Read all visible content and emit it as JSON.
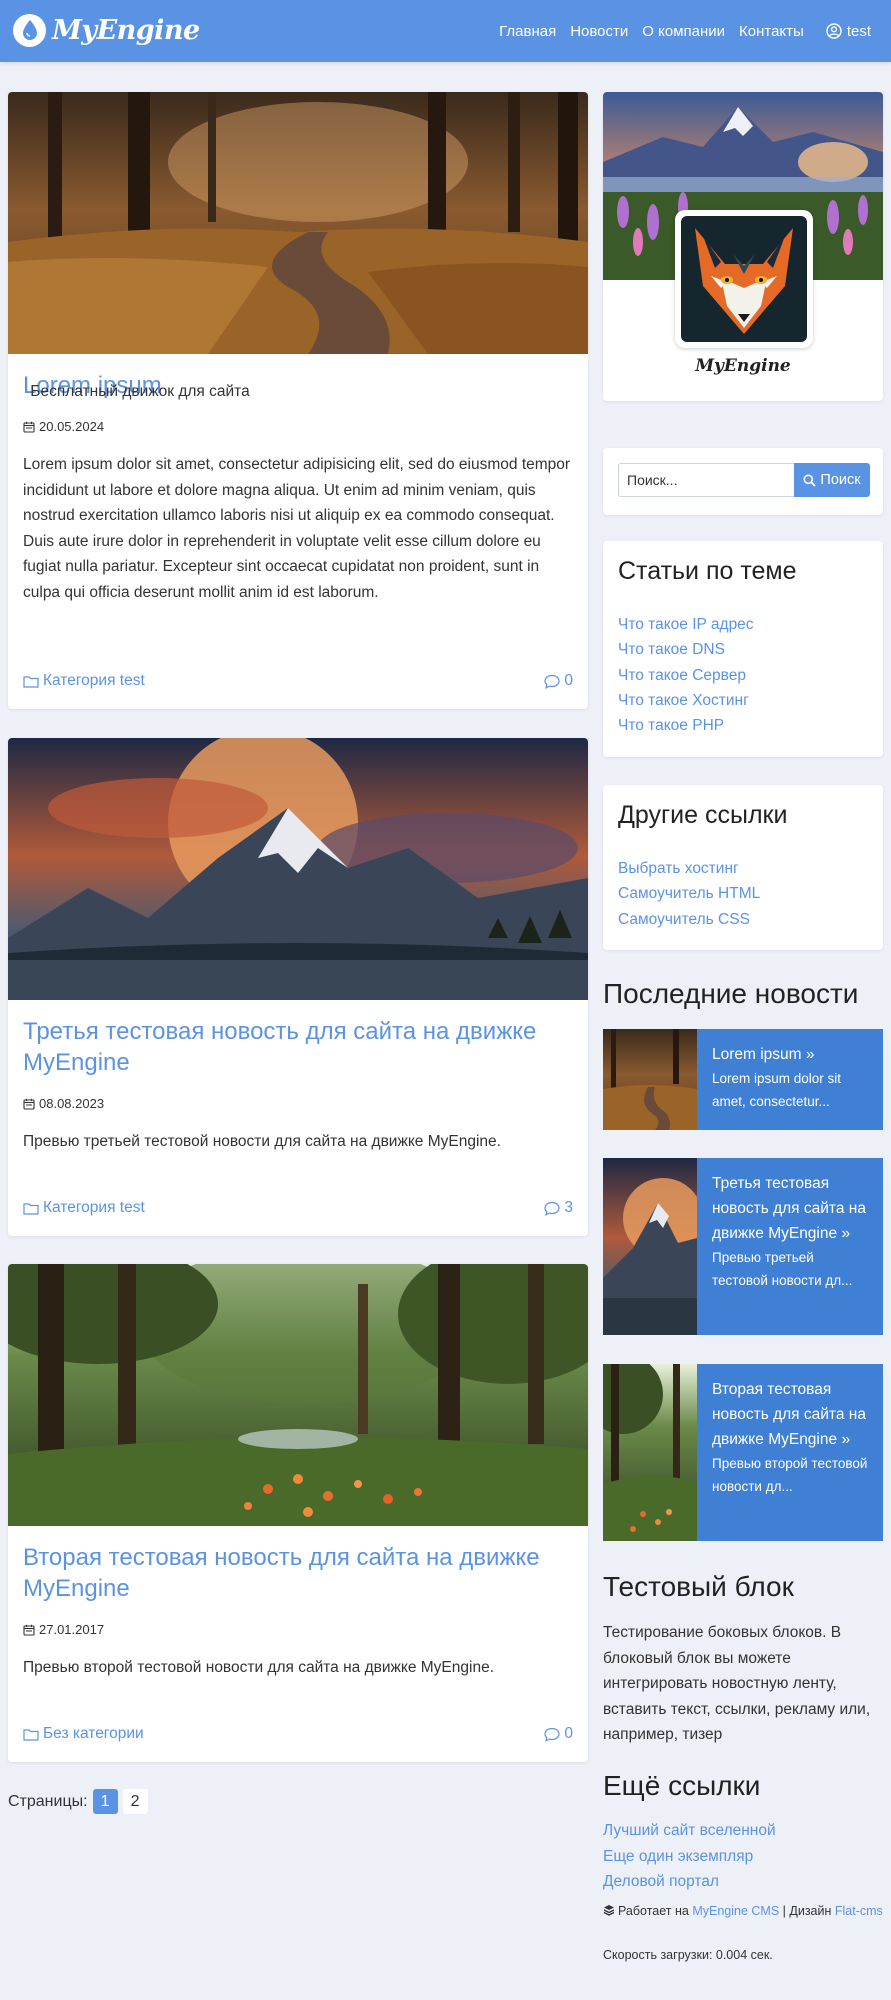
{
  "header": {
    "logo_text": "MyEngine",
    "nav": [
      "Главная",
      "Новости",
      "О компании",
      "Контакты"
    ],
    "user": "test"
  },
  "articles": [
    {
      "title": "Lorem ipsum",
      "date": "20.05.2024",
      "text": "Lorem ipsum dolor sit amet, consectetur adipisicing elit, sed do eiusmod tempor incididunt ut labore et dolore magna aliqua. Ut enim ad minim veniam, quis nostrud exercitation ullamco laboris nisi ut aliquip ex ea commodo consequat. Duis aute irure dolor in reprehenderit in voluptate velit esse cillum dolore eu fugiat nulla pariatur. Excepteur sint occaecat cupidatat non proident, sunt in culpa qui officia deserunt mollit anim id est laborum.",
      "category": "Категория test",
      "comments": "0"
    },
    {
      "title": "Третья тестовая новость для сайта на движке MyEngine",
      "date": "08.08.2023",
      "text": "Превью третьей тестовой новости для сайта на движке MyEngine.",
      "category": "Категория test",
      "comments": "3"
    },
    {
      "title": "Вторая тестовая новость для сайта на движке MyEngine",
      "date": "27.01.2017",
      "text": "Превью второй тестовой новости для сайта на движке MyEngine.",
      "category": "Без категории",
      "comments": "0"
    }
  ],
  "pagination": {
    "label": "Страницы:",
    "pages": [
      "1",
      "2"
    ],
    "current": "1"
  },
  "sidebar": {
    "profile": {
      "name": "MyEngine",
      "description": "Бесплатный движок для сайта"
    },
    "search": {
      "placeholder": "Поиск...",
      "button": "Поиск"
    },
    "related": {
      "title": "Статьи по теме",
      "links": [
        "Что такое IP адрес",
        "Что такое DNS",
        "Что такое Сервер",
        "Что такое Хостинг",
        "Что такое PHP"
      ]
    },
    "other": {
      "title": "Другие ссылки",
      "links": [
        "Выбрать хостинг",
        "Самоучитель HTML",
        "Самоучитель CSS"
      ]
    },
    "latest": {
      "title": "Последние новости",
      "items": [
        {
          "title": "Lorem ipsum",
          "preview": "Lorem ipsum dolor sit amet, consectetur..."
        },
        {
          "title": "Третья тестовая новость для сайта на движке MyEngine",
          "preview": "Превью третьей тестовой новости дл..."
        },
        {
          "title": "Вторая тестовая новость для сайта на движке MyEngine",
          "preview": "Превью второй тестовой новости дл..."
        }
      ]
    },
    "test_block": {
      "title": "Тестовый блок",
      "text": "Тестирование боковых блоков. В блоковый блок вы можете интегрировать новостную ленту, вставить текст, ссылки, рекламу или, например, тизер"
    },
    "more": {
      "title": "Ещё ссылки",
      "links": [
        "Лучший сайт вселенной",
        "Еще один экземпляр",
        "Деловой портал"
      ]
    },
    "footer": {
      "powered_prefix": "Работает на",
      "powered_link": "MyEngine CMS",
      "design_prefix": "| Дизайн",
      "design_link": "Flat-cms",
      "speed": "Скорость загрузки: 0.004 сек."
    }
  },
  "colors": {
    "accent": "#5b93e4",
    "news_bg": "#3f7fd4",
    "page_bg": "#eef0f8"
  }
}
